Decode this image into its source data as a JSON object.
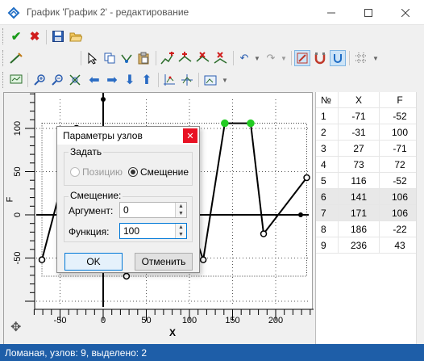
{
  "window": {
    "title": "График 'График 2' - редактирование"
  },
  "plot": {
    "x_axis_label": "X",
    "y_axis_label": "F",
    "x_ticks": [
      "-50",
      "0",
      "50",
      "100",
      "150",
      "200"
    ],
    "y_ticks": [
      "100",
      "50",
      "0",
      "-50"
    ]
  },
  "table": {
    "headers": [
      "№",
      "X",
      "F"
    ],
    "rows": [
      {
        "n": "1",
        "x": "-71",
        "f": "-52"
      },
      {
        "n": "2",
        "x": "-31",
        "f": "100"
      },
      {
        "n": "3",
        "x": "27",
        "f": "-71"
      },
      {
        "n": "4",
        "x": "73",
        "f": "72"
      },
      {
        "n": "5",
        "x": "116",
        "f": "-52"
      },
      {
        "n": "6",
        "x": "141",
        "f": "106"
      },
      {
        "n": "7",
        "x": "171",
        "f": "106"
      },
      {
        "n": "8",
        "x": "186",
        "f": "-22"
      },
      {
        "n": "9",
        "x": "236",
        "f": "43"
      }
    ]
  },
  "dialog": {
    "title": "Параметры узлов",
    "set_group": "Задать",
    "radio_position": "Позицию",
    "radio_offset": "Смещение",
    "offset_group": "Смещение:",
    "argument_label": "Аргумент:",
    "argument_value": "0",
    "function_label": "Функция:",
    "function_value": "100",
    "ok": "OK",
    "cancel": "Отменить"
  },
  "status": {
    "text": "Ломаная, узлов: 9, выделено: 2"
  },
  "colors": {
    "status_bg": "#1e5ea8",
    "selected_node": "#22cc22",
    "close_red": "#e81123"
  }
}
